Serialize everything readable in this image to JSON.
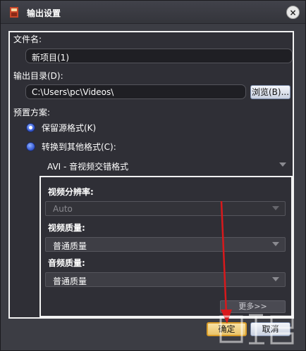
{
  "window": {
    "title": "输出设置",
    "close_glyph": "×"
  },
  "form": {
    "filename_label": "文件名:",
    "filename_value": "新项目(1)",
    "output_dir_label": "输出目录(D):",
    "output_dir_value": "C:\\Users\\pc\\Videos\\",
    "browse_label": "浏览(B)...",
    "preset_label": "预置方案:",
    "radio_keep_label": "保留源格式(K)",
    "radio_convert_label": "转换到其他格式(C):",
    "selected_radio": "keep",
    "format_value": "AVI - 音视频交错格式"
  },
  "subpanel": {
    "resolution_label": "视频分辨率:",
    "resolution_value": "Auto",
    "video_quality_label": "视频质量:",
    "video_quality_value": "普通质量",
    "audio_quality_label": "音频质量:",
    "audio_quality_value": "普通质量",
    "more_label": "更多>>"
  },
  "footer": {
    "ok_label": "确定",
    "cancel_label": "取消"
  },
  "annotation": {
    "arrow_color": "#d7191c"
  }
}
